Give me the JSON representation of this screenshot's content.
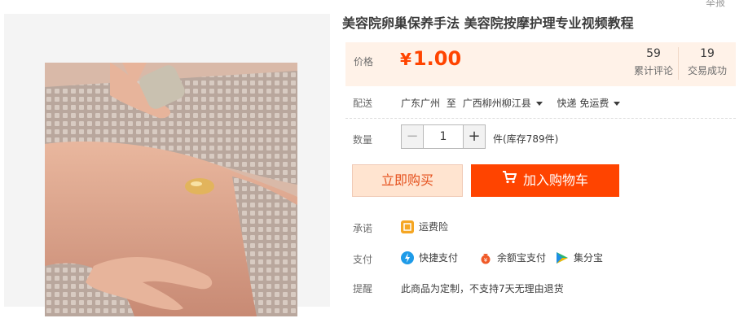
{
  "top_corner_text": "举报",
  "product": {
    "title": "美容院卵巢保养手法 美容院按摩护理专业视频教程",
    "image_alt": "massage"
  },
  "price": {
    "label": "价格",
    "currency": "¥",
    "value": "1.00",
    "review_count": "59",
    "review_label": "累计评论",
    "trade_count": "19",
    "trade_label": "交易成功"
  },
  "shipping": {
    "label": "配送",
    "from": "广东广州",
    "to_word": "至",
    "to": "广西柳州柳江县",
    "method": "快递 免运费"
  },
  "quantity": {
    "label": "数量",
    "minus": "−",
    "value": "1",
    "plus": "+",
    "stock": "件(库存789件)"
  },
  "actions": {
    "buy_now": "立即购买",
    "add_cart": "加入购物车"
  },
  "promise": {
    "label": "承诺",
    "item": "运费险"
  },
  "payment": {
    "label": "支付",
    "items": [
      "快捷支付",
      "余额宝支付",
      "集分宝"
    ]
  },
  "reminder": {
    "label": "提醒",
    "text": "此商品为定制，不支持7天无理由退货"
  },
  "colors": {
    "accent": "#ff4400",
    "price_bg": "#fff2e8"
  }
}
